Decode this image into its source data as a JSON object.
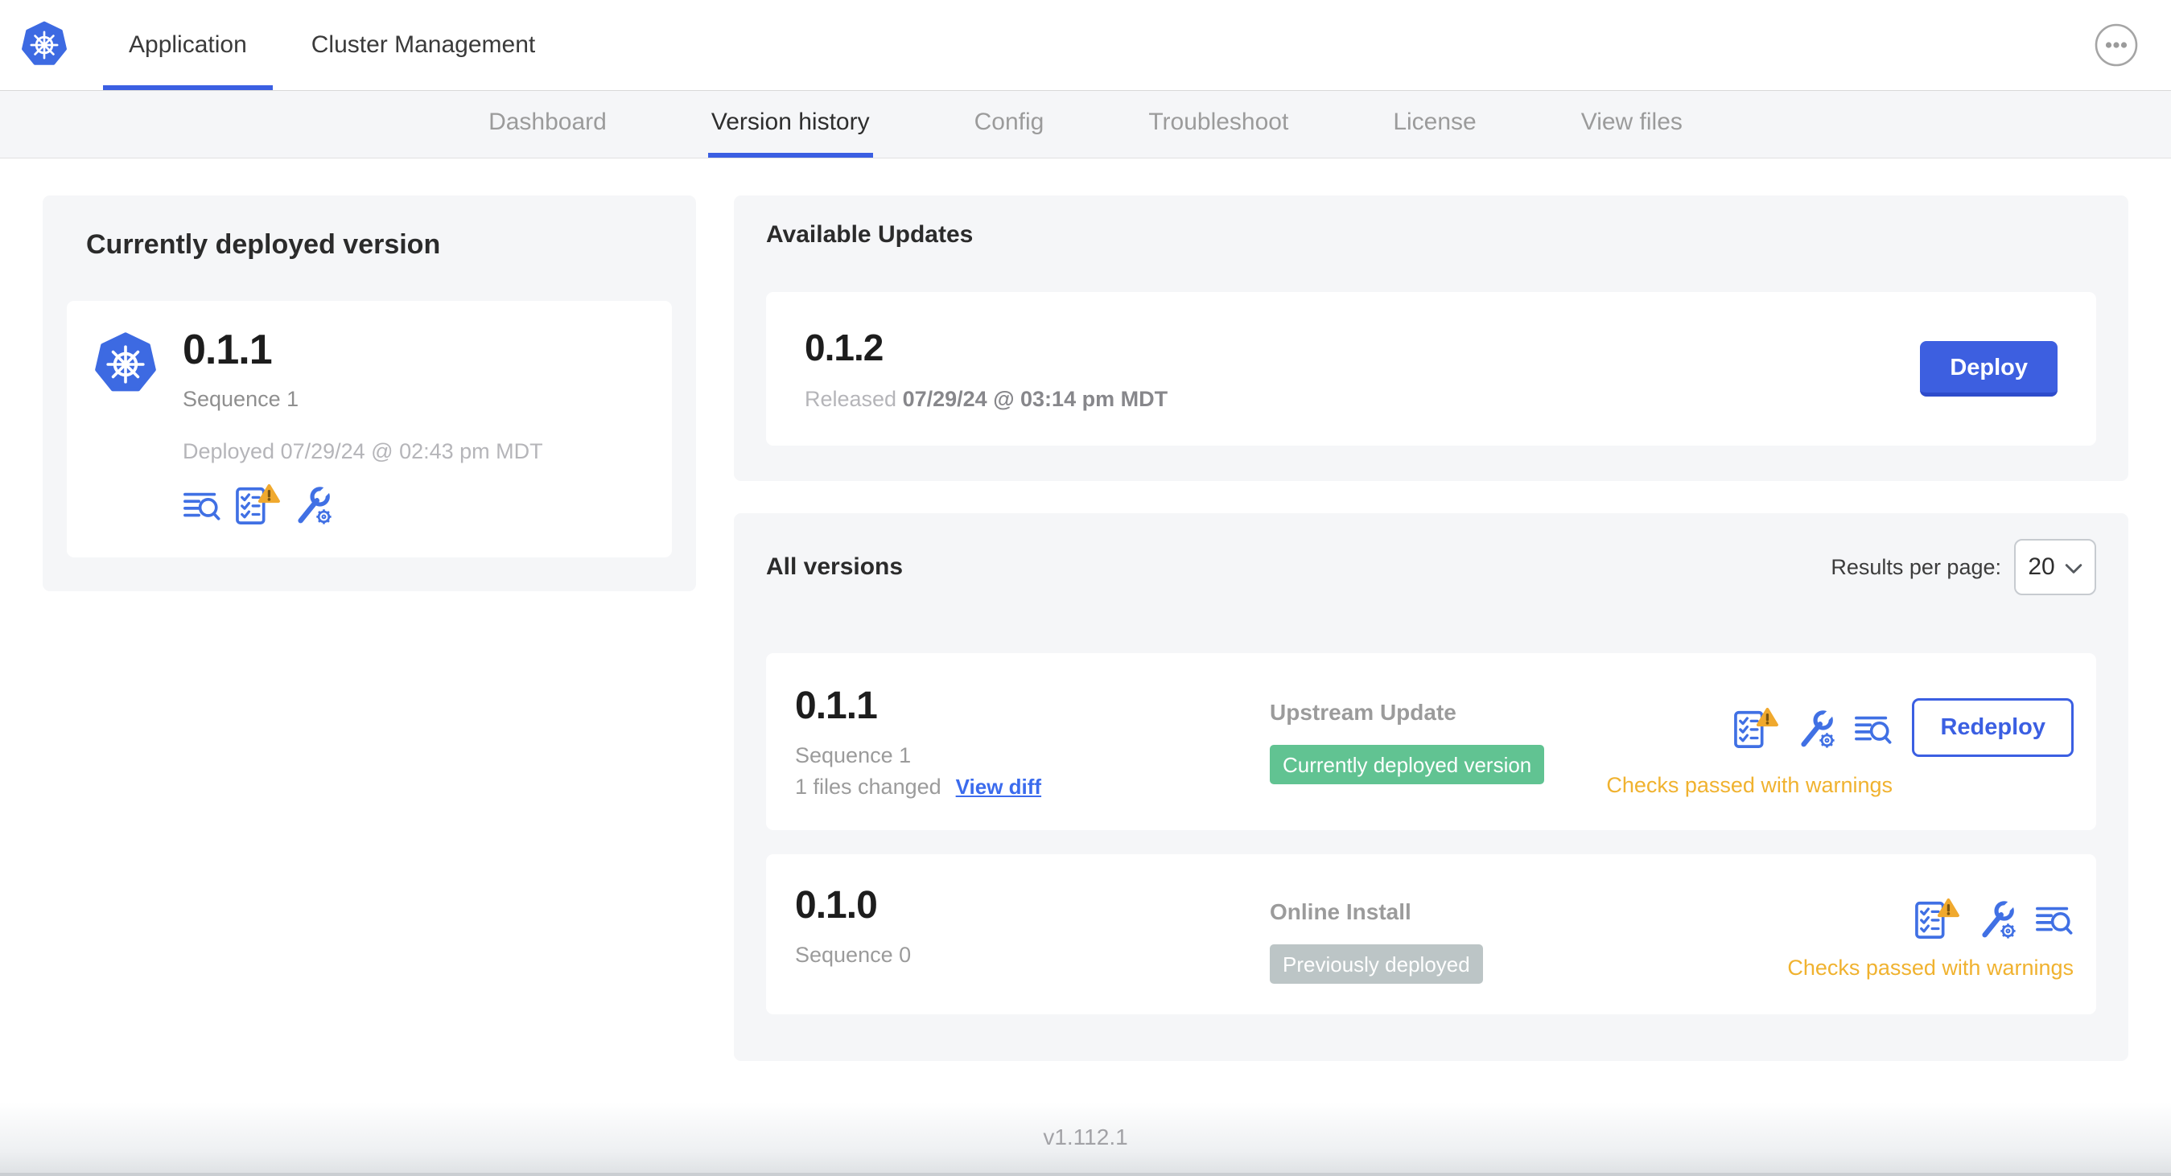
{
  "header": {
    "tabs": [
      {
        "label": "Application",
        "active": true
      },
      {
        "label": "Cluster Management",
        "active": false
      }
    ],
    "overflow_menu_icon": "ellipsis-icon",
    "logo_icon": "kubernetes-logo-icon"
  },
  "subnav": {
    "tabs": [
      {
        "label": "Dashboard"
      },
      {
        "label": "Version history"
      },
      {
        "label": "Config"
      },
      {
        "label": "Troubleshoot"
      },
      {
        "label": "License"
      },
      {
        "label": "View files"
      }
    ],
    "active_tab": "Version history"
  },
  "currently_deployed": {
    "title": "Currently deployed version",
    "version": "0.1.1",
    "sequence": "Sequence 1",
    "deployed_at": "Deployed 07/29/24 @ 02:43 pm MDT",
    "icons": [
      "release-notes-icon",
      "preflight-checks-warning-icon",
      "config-icon"
    ]
  },
  "available_updates": {
    "title": "Available Updates",
    "version": "0.1.2",
    "released_label": "Released",
    "released_at": "07/29/24 @ 03:14 pm MDT",
    "deploy_button": "Deploy"
  },
  "all_versions": {
    "title": "All versions",
    "results_per_page_label": "Results per page:",
    "results_per_page_value": "20",
    "rows": [
      {
        "version": "0.1.1",
        "sequence": "Sequence 1",
        "files_changed": "1 files changed",
        "view_diff_label": "View diff",
        "source": "Upstream Update",
        "badge_label": "Currently deployed version",
        "badge_style": "green",
        "status_text": "Checks passed with warnings",
        "action_button": "Redeploy",
        "icons": [
          "preflight-checks-warning-icon",
          "config-icon",
          "release-notes-icon"
        ]
      },
      {
        "version": "0.1.0",
        "sequence": "Sequence 0",
        "source": "Online Install",
        "badge_label": "Previously deployed",
        "badge_style": "gray",
        "status_text": "Checks passed with warnings",
        "icons": [
          "preflight-checks-warning-icon",
          "config-icon",
          "release-notes-icon"
        ]
      }
    ]
  },
  "footer": {
    "version": "v1.112.1"
  },
  "colors": {
    "accent_blue": "#3b5fe2",
    "icon_blue": "#4070e4",
    "link_blue": "#3b6bed",
    "warning_amber": "#f0b22f",
    "warning_triangle": "#f0a92e",
    "badge_green": "#61c392",
    "badge_gray": "#bcc5c6",
    "card_gray": "#f5f6f8",
    "text_dark": "#323232",
    "text_gray": "#9b9b9b",
    "text_light_gray": "#b5b5b9"
  }
}
